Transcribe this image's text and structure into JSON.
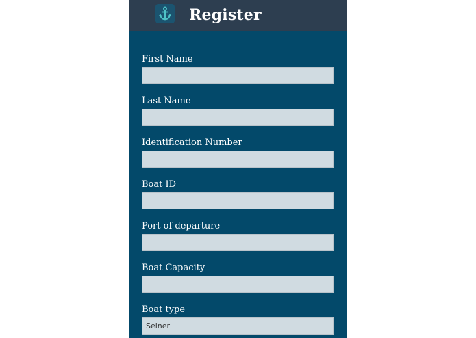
{
  "header": {
    "title": "Register",
    "logo_icon": "anchor-icon"
  },
  "form": {
    "first_name": {
      "label": "First Name",
      "value": ""
    },
    "last_name": {
      "label": "Last Name",
      "value": ""
    },
    "identification_number": {
      "label": "Identification Number",
      "value": ""
    },
    "boat_id": {
      "label": "Boat ID",
      "value": ""
    },
    "port_of_departure": {
      "label": "Port of departure",
      "value": ""
    },
    "boat_capacity": {
      "label": "Boat Capacity",
      "value": ""
    },
    "boat_type": {
      "label": "Boat type",
      "value": "Seiner"
    }
  },
  "colors": {
    "background": "#03496a",
    "header": "#2d3e50",
    "input": "#d0dbe1",
    "accent": "#4fc3c7"
  }
}
